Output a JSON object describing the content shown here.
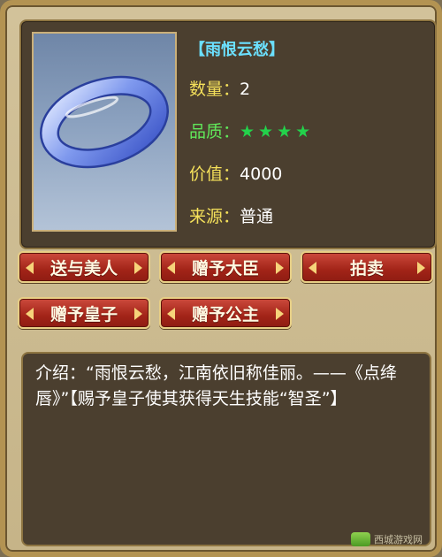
{
  "item": {
    "title": "【雨恨云愁】",
    "quantity_label": "数量：",
    "quantity_value": "2",
    "quality_label": "品质：",
    "quality_stars": "★★★★",
    "value_label": "价值：",
    "value_value": "4000",
    "source_label": "来源：",
    "source_value": "普通"
  },
  "buttons": {
    "gift_beauty": "送与美人",
    "gift_minister": "赠予大臣",
    "auction": "拍卖",
    "gift_prince": "赠予皇子",
    "gift_princess": "赠予公主"
  },
  "description": {
    "text": "介绍：“雨恨云愁，江南依旧称佳丽。——《点绛唇》”【赐予皇子使其获得天生技能“智圣”】"
  },
  "watermark": {
    "text": "西城游戏网"
  },
  "colors": {
    "title": "#6be0ff",
    "label": "#f4e05a",
    "quality": "#60e85a",
    "button": "#a22418"
  }
}
